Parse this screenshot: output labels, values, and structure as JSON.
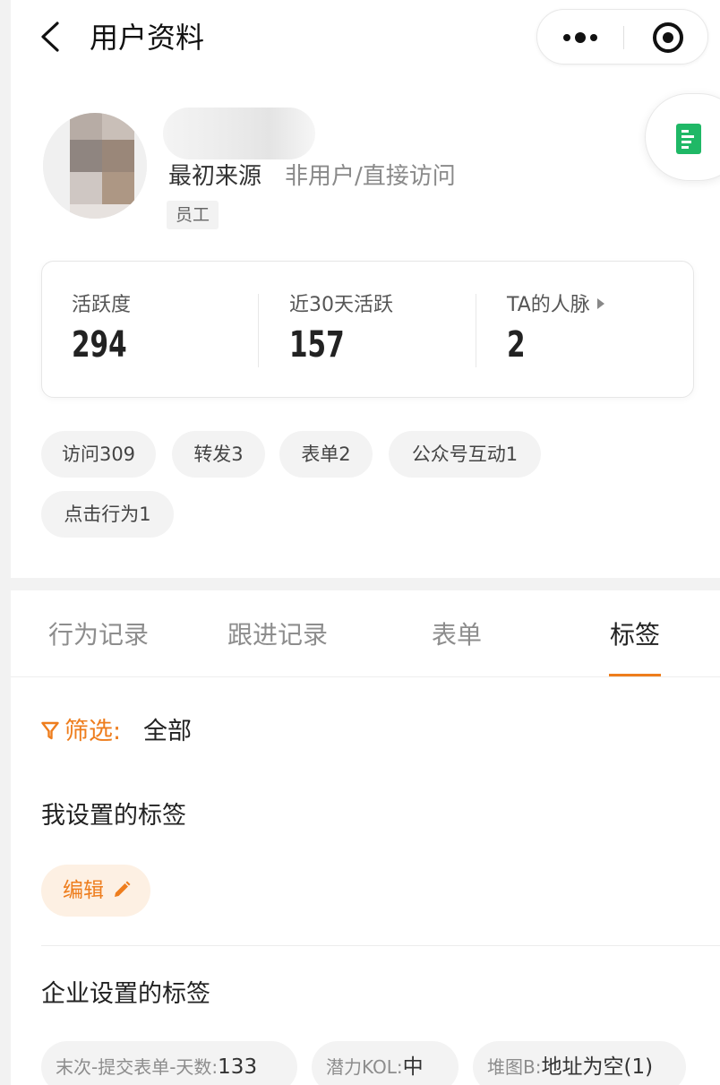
{
  "nav": {
    "title": "用户资料"
  },
  "profile": {
    "origin_label": "最初来源",
    "origin_value": "非用户/直接访问",
    "role": "员工"
  },
  "stats": [
    {
      "label": "活跃度",
      "value": "294"
    },
    {
      "label": "近30天活跃",
      "value": "157"
    },
    {
      "label": "TA的人脉",
      "value": "2"
    }
  ],
  "behavior_chips": [
    "访问309",
    "转发3",
    "表单2",
    "公众号互动1",
    "点击行为1"
  ],
  "tabs": [
    "行为记录",
    "跟进记录",
    "表单",
    "标签"
  ],
  "active_tab": "标签",
  "filter": {
    "label": "筛选:",
    "value": "全部"
  },
  "my_tags": {
    "title": "我设置的标签",
    "edit_label": "编辑"
  },
  "corp_tags": {
    "title": "企业设置的标签",
    "items": [
      {
        "key": "末次-提交表单-天数:",
        "value": "133"
      },
      {
        "key": "潜力KOL:",
        "value": "中"
      },
      {
        "key": "堆图B:",
        "value": "地址为空(1)"
      }
    ]
  },
  "colors": {
    "accent": "#ee7d1d",
    "float_icon": "#1fb866"
  },
  "icons": [
    "back-icon",
    "more-icon",
    "close-mini-program-icon",
    "document-icon",
    "filter-icon",
    "pencil-icon",
    "triangle-right-icon"
  ]
}
